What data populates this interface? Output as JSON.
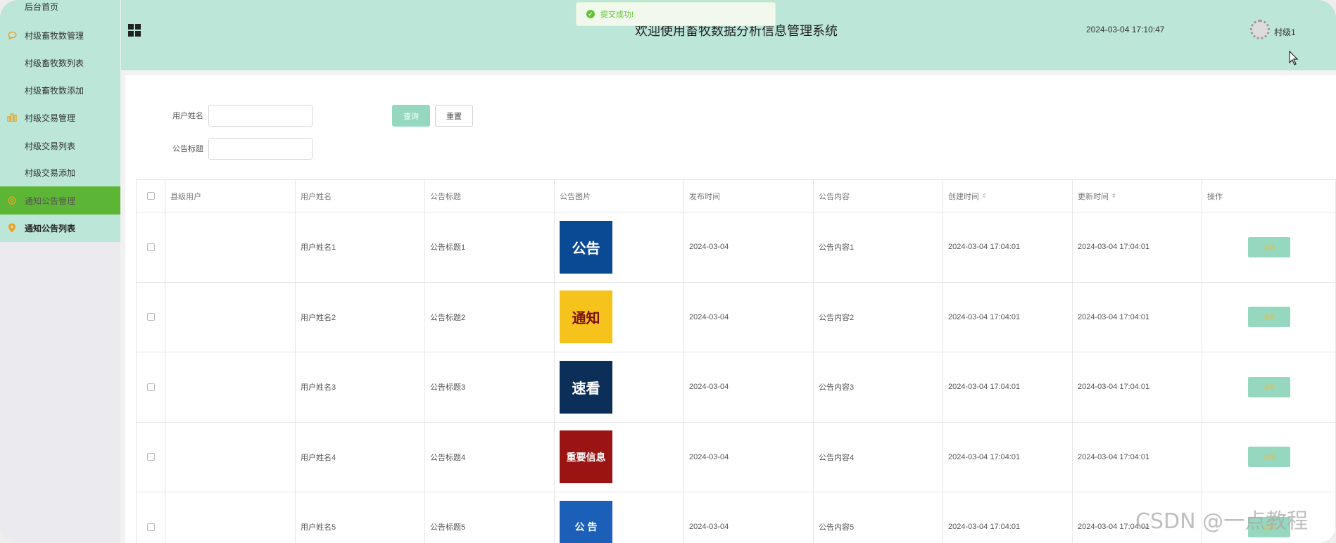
{
  "sidebar": {
    "items": [
      {
        "label": "后台首页",
        "type": "sub"
      },
      {
        "label": "村级畜牧数管理",
        "type": "group",
        "icon": "chat-icon"
      },
      {
        "label": "村级畜牧数列表",
        "type": "sub"
      },
      {
        "label": "村级畜牧数添加",
        "type": "sub"
      },
      {
        "label": "村级交易管理",
        "type": "group",
        "icon": "bar-chart-icon"
      },
      {
        "label": "村级交易列表",
        "type": "sub"
      },
      {
        "label": "村级交易添加",
        "type": "sub"
      },
      {
        "label": "通知公告管理",
        "type": "group-active",
        "icon": "gear-icon"
      },
      {
        "label": "通知公告列表",
        "type": "group-bold",
        "icon": "location-pin-icon"
      }
    ]
  },
  "header": {
    "title": "欢迎使用畜牧数据分析信息管理系统",
    "datetime": "2024-03-04 17:10:47",
    "username": "村级1"
  },
  "toast": {
    "message": "提交成功!",
    "icon": "check-circle-icon",
    "color": "#67c23a"
  },
  "search": {
    "username_label": "用户姓名",
    "title_label": "公告标题",
    "username_value": "",
    "title_value": "",
    "query_label": "查询",
    "reset_label": "重置"
  },
  "table": {
    "columns": [
      "县级用户",
      "用户姓名",
      "公告标题",
      "公告图片",
      "发布时间",
      "公告内容",
      "创建时间",
      "更新时间",
      "操作"
    ],
    "rows": [
      {
        "county_user": "",
        "username": "用户姓名1",
        "title": "公告标题1",
        "image_text": "公告",
        "image_bg": "#0a4a94",
        "image_fg": "#ffffff",
        "publish": "2024-03-04",
        "content": "公告内容1",
        "created": "2024-03-04 17:04:01",
        "updated": "2024-03-04 17:04:01",
        "action": "详情"
      },
      {
        "county_user": "",
        "username": "用户姓名2",
        "title": "公告标题2",
        "image_text": "通知",
        "image_bg": "#f6c21c",
        "image_fg": "#7a1010",
        "publish": "2024-03-04",
        "content": "公告内容2",
        "created": "2024-03-04 17:04:01",
        "updated": "2024-03-04 17:04:01",
        "action": "详情"
      },
      {
        "county_user": "",
        "username": "用户姓名3",
        "title": "公告标题3",
        "image_text": "速看",
        "image_bg": "#0c2f5a",
        "image_fg": "#ffffff",
        "publish": "2024-03-04",
        "content": "公告内容3",
        "created": "2024-03-04 17:04:01",
        "updated": "2024-03-04 17:04:01",
        "action": "详情"
      },
      {
        "county_user": "",
        "username": "用户姓名4",
        "title": "公告标题4",
        "image_text": "重要信息",
        "image_bg": "#9a1414",
        "image_fg": "#ffffff",
        "publish": "2024-03-04",
        "content": "公告内容4",
        "created": "2024-03-04 17:04:01",
        "updated": "2024-03-04 17:04:01",
        "action": "详情"
      },
      {
        "county_user": "",
        "username": "用户姓名5",
        "title": "公告标题5",
        "image_text": "公 告",
        "image_bg": "#1b5fb8",
        "image_fg": "#ffffff",
        "publish": "2024-03-04",
        "content": "公告内容5",
        "created": "2024-03-04 17:04:01",
        "updated": "2024-03-04 17:04:01",
        "action": "详情"
      }
    ]
  },
  "watermark": "CSDN @一点教程",
  "colors": {
    "header_bg": "#bce6d7",
    "active_menu": "#5db535",
    "primary_button": "#95d8bf"
  }
}
